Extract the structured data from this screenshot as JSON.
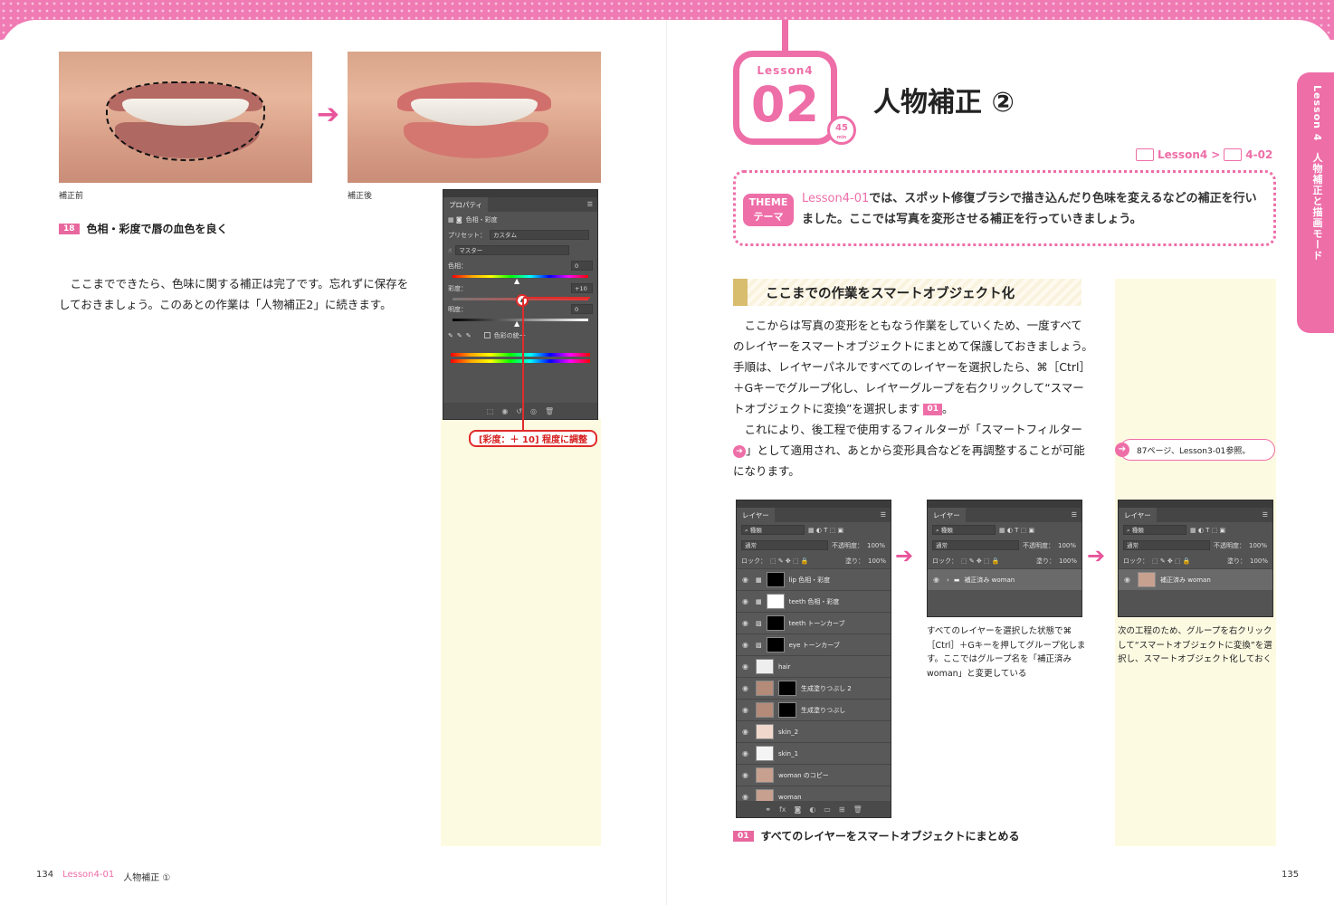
{
  "left": {
    "before_caption": "補正前",
    "after_caption": "補正後",
    "step": {
      "num": "18",
      "label": "色相・彩度で唇の血色を良く"
    },
    "body": [
      "　ここまでできたら、色味に関する補正は完了です。忘れずに保存を",
      "しておきましょう。このあとの作業は「人物補正2」に続きます。"
    ],
    "properties_panel": {
      "tab": "プロパティ",
      "title": "色相・彩度",
      "preset_label": "プリセット：",
      "preset_value": "カスタム",
      "channel_value": "マスター",
      "hue_label": "色相：",
      "hue_value": "0",
      "sat_label": "彩度：",
      "sat_value": "+10",
      "light_label": "明度：",
      "light_value": "0",
      "colorize_label": "色彩の統一"
    },
    "callout": "[彩度：＋ 10] 程度に調整"
  },
  "right": {
    "badge_lesson": "Lesson4",
    "badge_num": "02",
    "clock_num": "45",
    "clock_unit": "min",
    "title": "人物補正 ②",
    "breadcrumb": [
      "Lesson4",
      ">",
      "4-02"
    ],
    "theme": {
      "badge_en": "THEME",
      "badge_ja": "テーマ",
      "highlight": "Lesson4-01",
      "text": "では、スポット修復ブラシで描き込んだり色味を変えるなどの補正を行いました。ここでは写真を変形させる補正を行っていきましょう。"
    },
    "section_title": "ここまでの作業をスマートオブジェクト化",
    "body": [
      "　ここからは写真の変形をともなう作業をしていくため、一度すべて",
      "のレイヤーをスマートオブジェクトにまとめて保護しておきましょう。",
      "手順は、レイヤーパネルですべてのレイヤーを選択したら、⌘［Ctrl］",
      "＋Gキーでグループ化し、レイヤーグループを右クリックして“スマー",
      "トオブジェクトに変換”を選択します",
      "　これにより、後工程で使用するフィルターが「スマートフィルター",
      "」として適用され、あとから変形具合などを再調整することが可能",
      "になります。"
    ],
    "body_step_badge": "01",
    "ref_note": "87ページ、Lesson3-01参照。",
    "side_tab": "Lesson 4　人物補正と描画モード",
    "layers_panel": {
      "tab": "レイヤー",
      "kind": "種類",
      "blend": "通常",
      "opacity_label": "不透明度：",
      "opacity": "100%",
      "lock_label": "ロック：",
      "fill_label": "塗り：",
      "fill": "100%",
      "layers": [
        "lip 色相・彩度",
        "teeth 色相・彩度",
        "teeth トーンカーブ",
        "eye トーンカーブ",
        "hair",
        "生成塗りつぶし 2",
        "生成塗りつぶし",
        "skin_2",
        "skin_1",
        "woman のコピー",
        "woman"
      ]
    },
    "group_panel_layer": "補正済み woman",
    "smart_panel_layer": "補正済み woman",
    "caption_group": [
      "すべてのレイヤーを選択した状態で⌘",
      "［Ctrl］＋Gキーを押してグループ化しま",
      "す。ここではグループ名を「補正済み",
      "woman」と変更している"
    ],
    "caption_smart": [
      "次の工程のため、グループを右クリック",
      "して“スマートオブジェクトに変換”を選",
      "択し、スマートオブジェクト化しておく"
    ],
    "step": {
      "num": "01",
      "label": "すべてのレイヤーをスマートオブジェクトにまとめる"
    }
  },
  "footer": {
    "left_page": "134",
    "left_lesson": "Lesson4-01",
    "left_title": "人物補正 ①",
    "right_page": "135"
  },
  "colors": {
    "accent": "#ee6ea8",
    "yellow": "#fdfae2",
    "red": "#e02b2b"
  }
}
